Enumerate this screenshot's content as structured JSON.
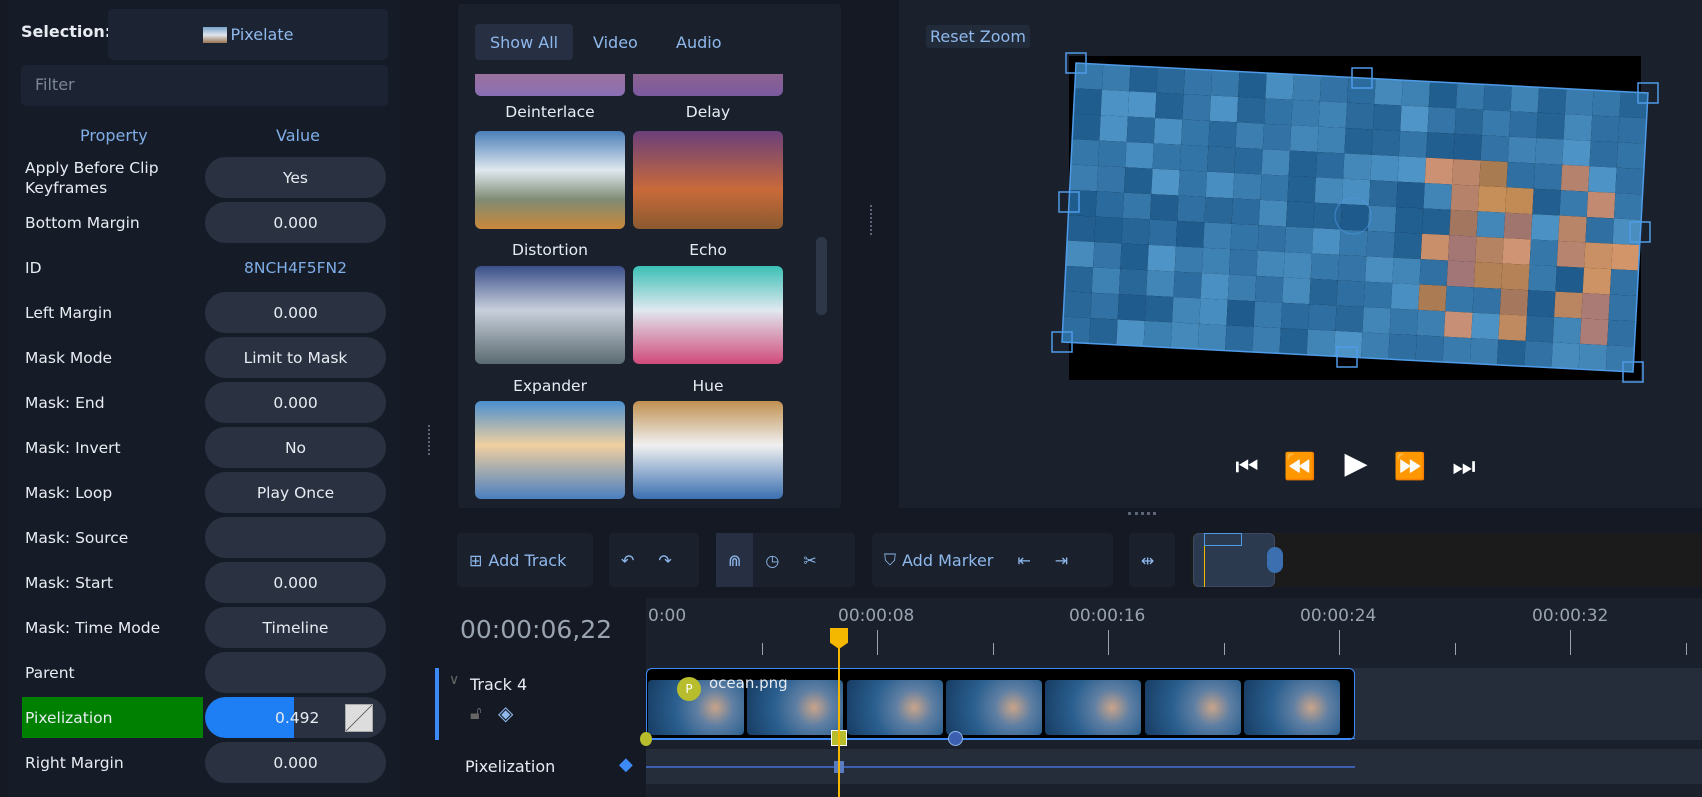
{
  "selection": {
    "label": "Selection:",
    "value": "Pixelate"
  },
  "filter": {
    "placeholder": "Filter"
  },
  "properties": {
    "header_property": "Property",
    "header_value": "Value",
    "rows": [
      {
        "name": "Apply Before Clip Keyframes",
        "value": "Yes"
      },
      {
        "name": "Bottom Margin",
        "value": "0.000"
      },
      {
        "name": "ID",
        "value": "8NCH4F5FN2"
      },
      {
        "name": "Left Margin",
        "value": "0.000"
      },
      {
        "name": "Mask Mode",
        "value": "Limit to Mask"
      },
      {
        "name": "Mask: End",
        "value": "0.000"
      },
      {
        "name": "Mask: Invert",
        "value": "No"
      },
      {
        "name": "Mask: Loop",
        "value": "Play Once"
      },
      {
        "name": "Mask: Source",
        "value": ""
      },
      {
        "name": "Mask: Start",
        "value": "0.000"
      },
      {
        "name": "Mask: Time Mode",
        "value": "Timeline"
      },
      {
        "name": "Parent",
        "value": ""
      },
      {
        "name": "Pixelization",
        "value": "0.492",
        "fraction": 0.492
      },
      {
        "name": "Right Margin",
        "value": "0.000"
      }
    ]
  },
  "effects": {
    "tabs": [
      "Show All",
      "Video",
      "Audio"
    ],
    "items": [
      "Deinterlace",
      "Delay",
      "Distortion",
      "Echo",
      "Expander",
      "Hue"
    ]
  },
  "preview": {
    "reset_zoom": "Reset Zoom"
  },
  "toolbar": {
    "add_track": "Add Track",
    "add_marker": "Add Marker"
  },
  "timeline": {
    "current_time": "00:00:06,22",
    "ruler": [
      "0:00",
      "00:00:08",
      "00:00:16",
      "00:00:24",
      "00:00:32"
    ],
    "track_name": "Track 4",
    "clip_name": "ocean.png",
    "clip_badge": "P",
    "keyframe_row": "Pixelization"
  },
  "colors": {
    "accent": "#3d8af7",
    "playhead": "#f5b800",
    "highlight": "#008000"
  }
}
